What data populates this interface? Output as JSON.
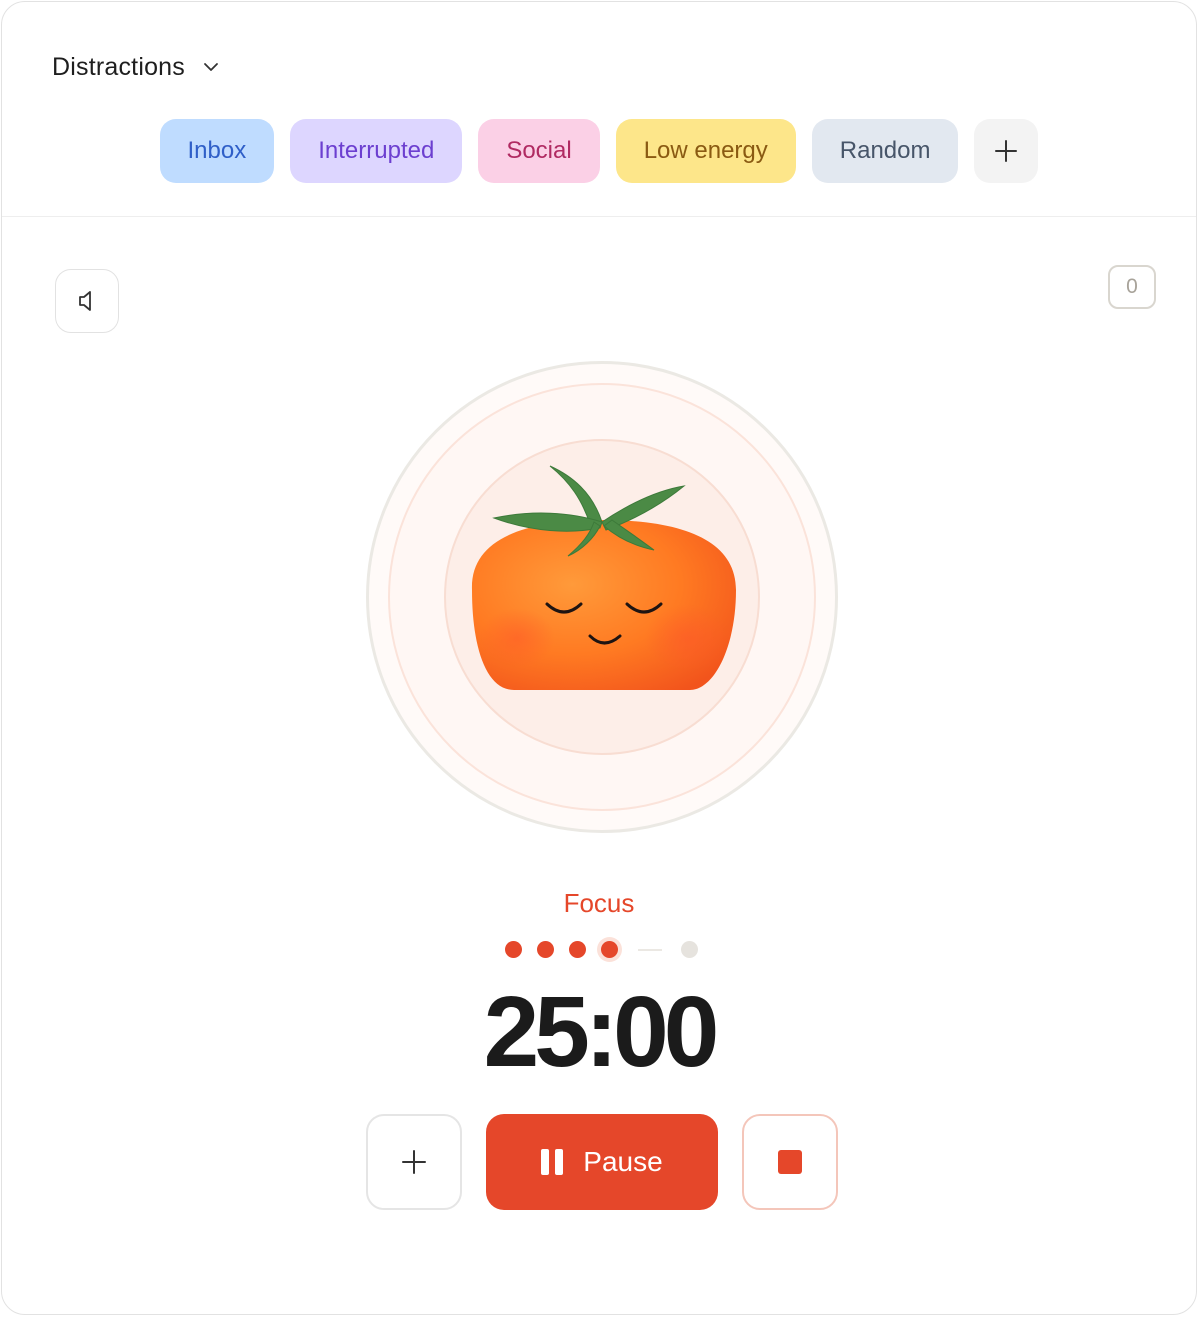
{
  "header": {
    "dropdown_label": "Distractions",
    "chips": [
      {
        "label": "Inbox",
        "bg": "#bfdcff",
        "fg": "#2f5fc8"
      },
      {
        "label": "Interrupted",
        "bg": "#ddd6ff",
        "fg": "#6c3fd0"
      },
      {
        "label": "Social",
        "bg": "#fbd0e6",
        "fg": "#b02a62"
      },
      {
        "label": "Low energy",
        "bg": "#fde68a",
        "fg": "#8a5a12"
      },
      {
        "label": "Random",
        "bg": "#e2e8f0",
        "fg": "#475569"
      }
    ]
  },
  "toolbar": {
    "distraction_count": "0"
  },
  "session": {
    "phase": "Focus",
    "completed_sessions": 4,
    "total_sessions": 5,
    "time": "25:00"
  },
  "controls": {
    "pause_label": "Pause"
  },
  "icons": [
    "chevron-down-icon",
    "plus-icon",
    "speaker-icon",
    "tomato-illustration",
    "pause-icon",
    "stop-icon"
  ],
  "colors": {
    "accent": "#e5472a"
  }
}
